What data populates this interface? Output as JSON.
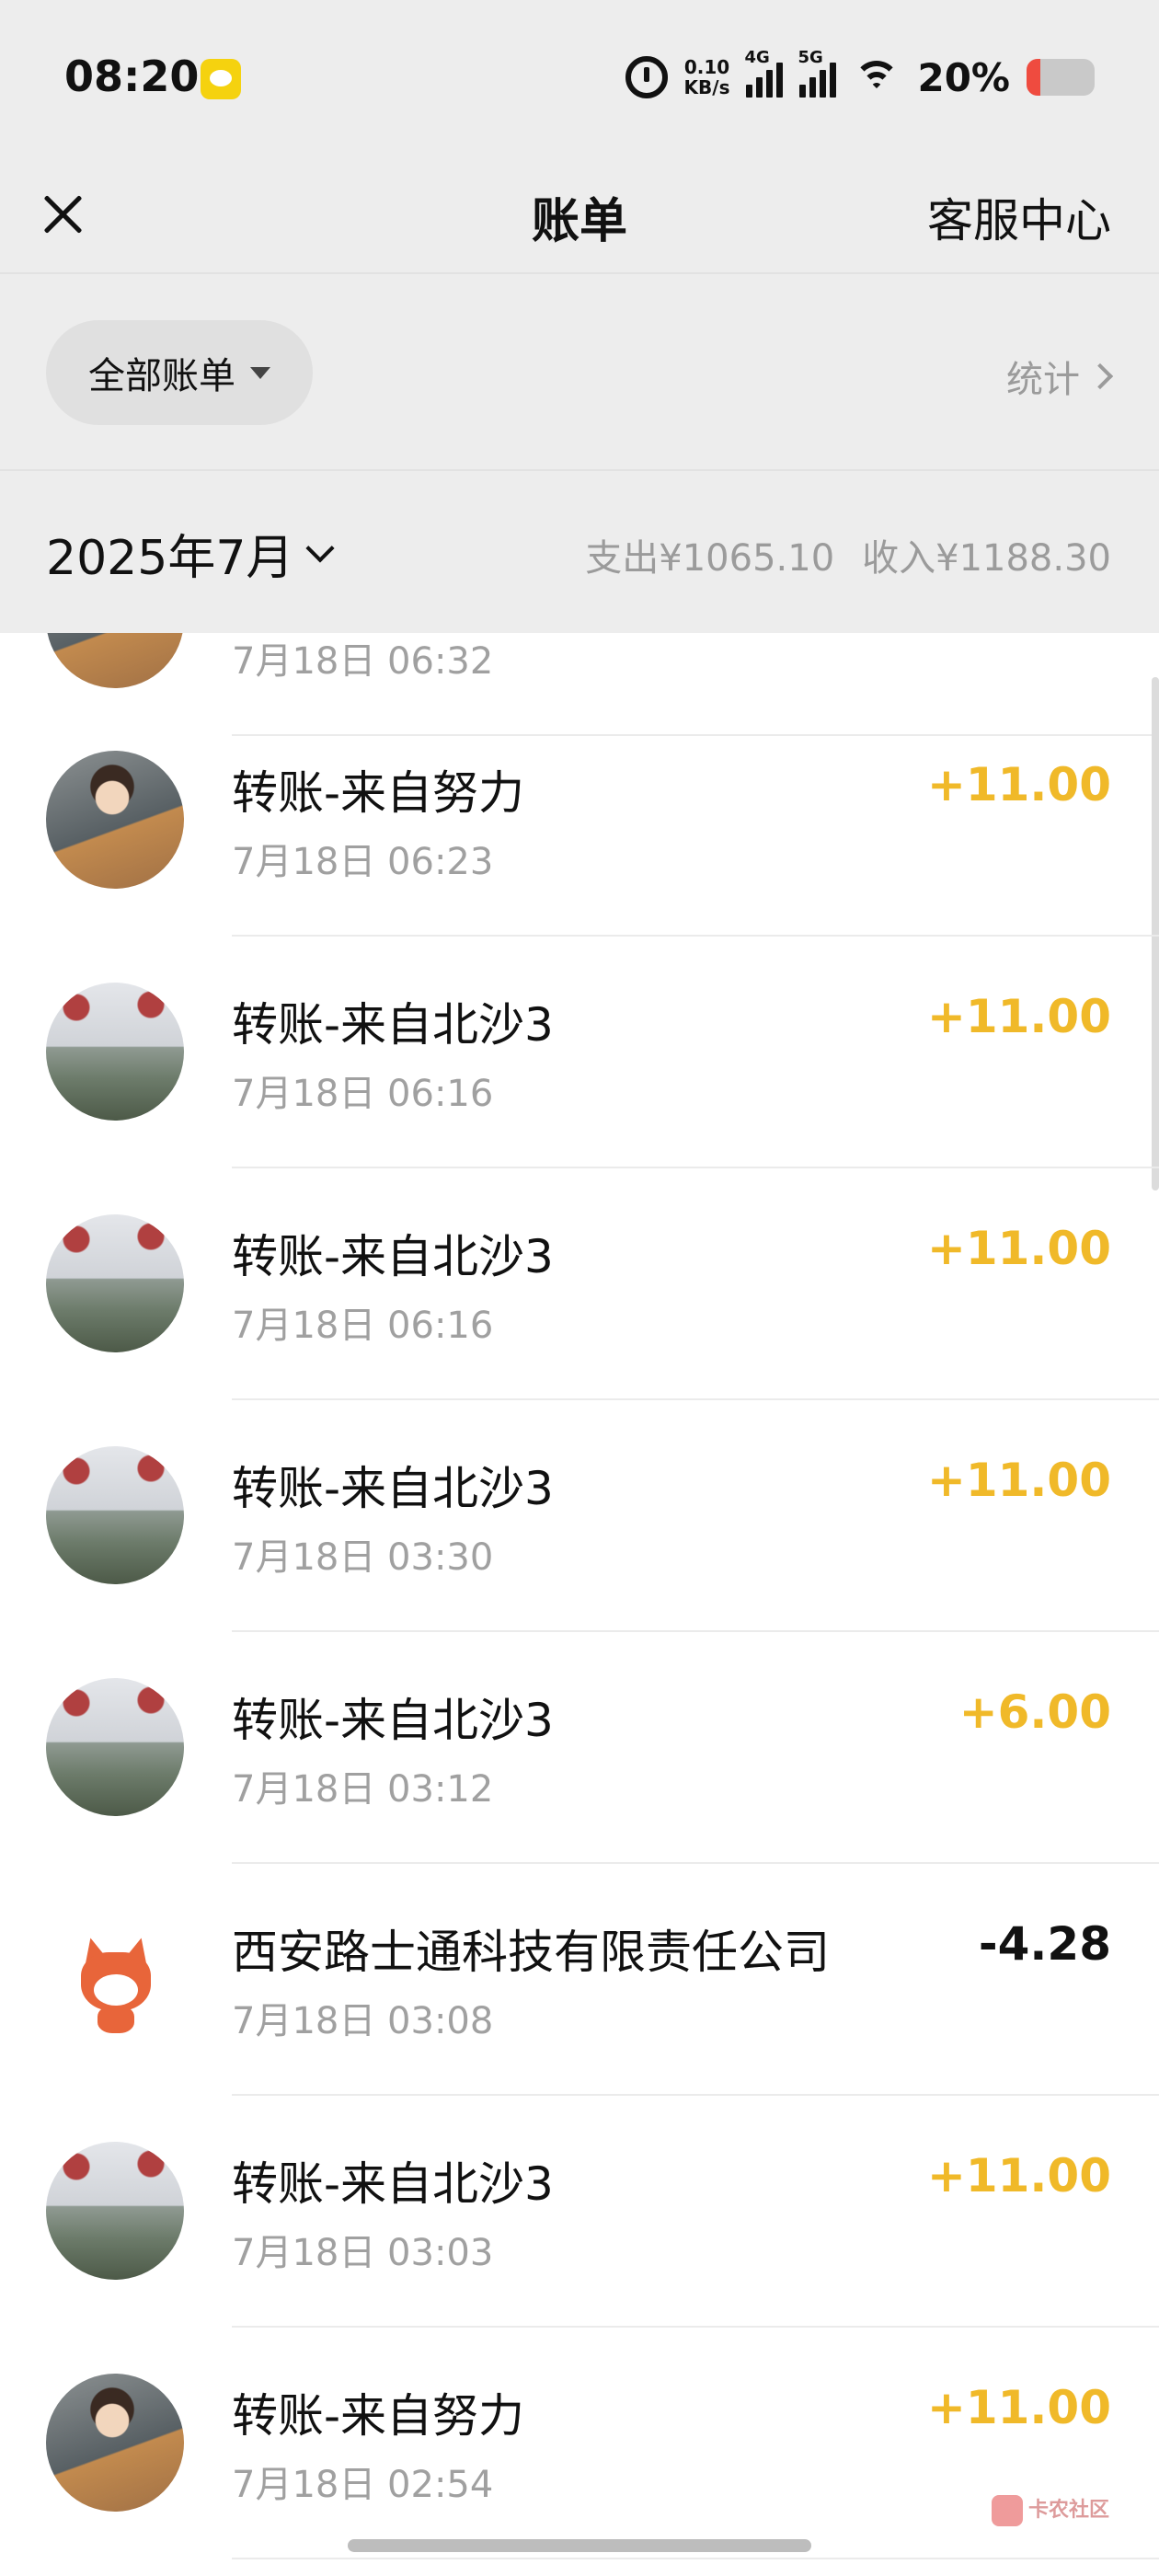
{
  "status_bar": {
    "time": "08:20",
    "net_speed_value": "0.10",
    "net_speed_unit": "KB/s",
    "signal_1": "4G",
    "signal_2": "5G",
    "battery": "20%",
    "battery_level": 0.2,
    "battery_color": "#ef4b3f"
  },
  "nav": {
    "title": "账单",
    "service": "客服中心"
  },
  "filter": {
    "label": "全部账单",
    "stats": "统计"
  },
  "month": {
    "label": "2025年7月",
    "expense": "支出¥1065.10",
    "income": "收入¥1188.30"
  },
  "colors": {
    "income_amount": "#f0b929",
    "expense_amount": "#111111"
  },
  "partial_row": {
    "time": "7月18日 06:32"
  },
  "transactions": [
    {
      "title": "转账-来自努力",
      "time": "7月18日 06:23",
      "amount": "+11.00",
      "avatar": "person-avatar"
    },
    {
      "title": "转账-来自北沙3",
      "time": "7月18日 06:16",
      "amount": "+11.00",
      "avatar": "landscape-avatar"
    },
    {
      "title": "转账-来自北沙3",
      "time": "7月18日 06:16",
      "amount": "+11.00",
      "avatar": "landscape-avatar"
    },
    {
      "title": "转账-来自北沙3",
      "time": "7月18日 03:30",
      "amount": "+11.00",
      "avatar": "landscape-avatar"
    },
    {
      "title": "转账-来自北沙3",
      "time": "7月18日 03:12",
      "amount": "+6.00",
      "avatar": "landscape-avatar"
    },
    {
      "title": "西安路士通科技有限责任公司",
      "time": "7月18日 03:08",
      "amount": "-4.28",
      "avatar": "fox-mascot-avatar"
    },
    {
      "title": "转账-来自北沙3",
      "time": "7月18日 03:03",
      "amount": "+11.00",
      "avatar": "landscape-avatar"
    },
    {
      "title": "转账-来自努力",
      "time": "7月18日 02:54",
      "amount": "+11.00",
      "avatar": "person-avatar"
    }
  ],
  "watermark": {
    "text": "卡农社区"
  }
}
